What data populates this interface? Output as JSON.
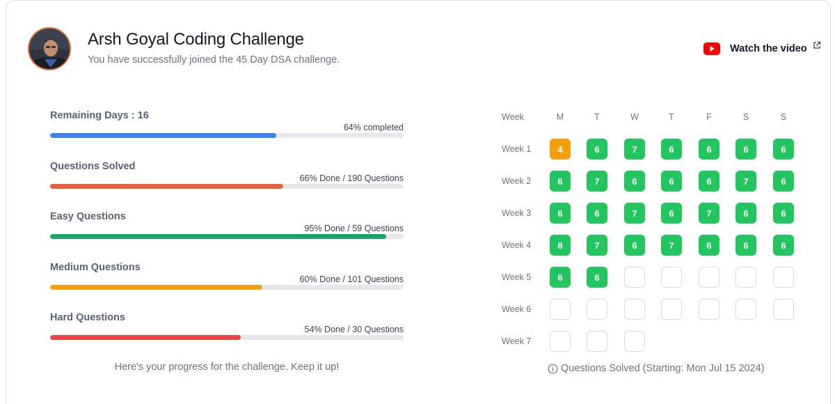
{
  "header": {
    "title": "Arsh Goyal Coding Challenge",
    "subtitle": "You have successfully joined the 45 Day DSA challenge.",
    "watch_label": "Watch the video"
  },
  "colors": {
    "blue": "#3b82f6",
    "orange": "#e8613a",
    "green": "#1aa46b",
    "amber": "#f5a10e",
    "red": "#ec4444",
    "cell_green": "#22c55e",
    "cell_amber": "#f59e0b"
  },
  "progress": [
    {
      "label": "Remaining Days : 16",
      "value": "64% completed",
      "fraction": 0.64,
      "color": "#3b82f6"
    },
    {
      "label": "Questions Solved",
      "value": "66% Done / 190 Questions",
      "fraction": 0.66,
      "color": "#e8613a"
    },
    {
      "label": "Easy Questions",
      "value": "95% Done / 59 Questions",
      "fraction": 0.95,
      "color": "#1aa46b"
    },
    {
      "label": "Medium Questions",
      "value": "60% Done / 101 Questions",
      "fraction": 0.6,
      "color": "#f5a10e"
    },
    {
      "label": "Hard Questions",
      "value": "54% Done / 30 Questions",
      "fraction": 0.54,
      "color": "#ec4444"
    }
  ],
  "encouragement": "Here's your progress for the challenge. Keep it up!",
  "calendar": {
    "week_header": "Week",
    "days": [
      "M",
      "T",
      "W",
      "T",
      "F",
      "S",
      "S"
    ],
    "weeks": [
      {
        "label": "Week 1",
        "cells": [
          4,
          6,
          7,
          6,
          6,
          6,
          6
        ]
      },
      {
        "label": "Week 2",
        "cells": [
          6,
          7,
          6,
          6,
          6,
          7,
          6
        ]
      },
      {
        "label": "Week 3",
        "cells": [
          6,
          6,
          7,
          6,
          7,
          6,
          6
        ]
      },
      {
        "label": "Week 4",
        "cells": [
          8,
          7,
          6,
          7,
          6,
          6,
          6
        ]
      },
      {
        "label": "Week 5",
        "cells": [
          6,
          6,
          null,
          null,
          null,
          null,
          null
        ]
      },
      {
        "label": "Week 6",
        "cells": [
          null,
          null,
          null,
          null,
          null,
          null,
          null
        ]
      },
      {
        "label": "Week 7",
        "cells": [
          null,
          null,
          null
        ]
      }
    ],
    "footer": "Questions Solved (Starting: Mon Jul 15 2024)"
  }
}
